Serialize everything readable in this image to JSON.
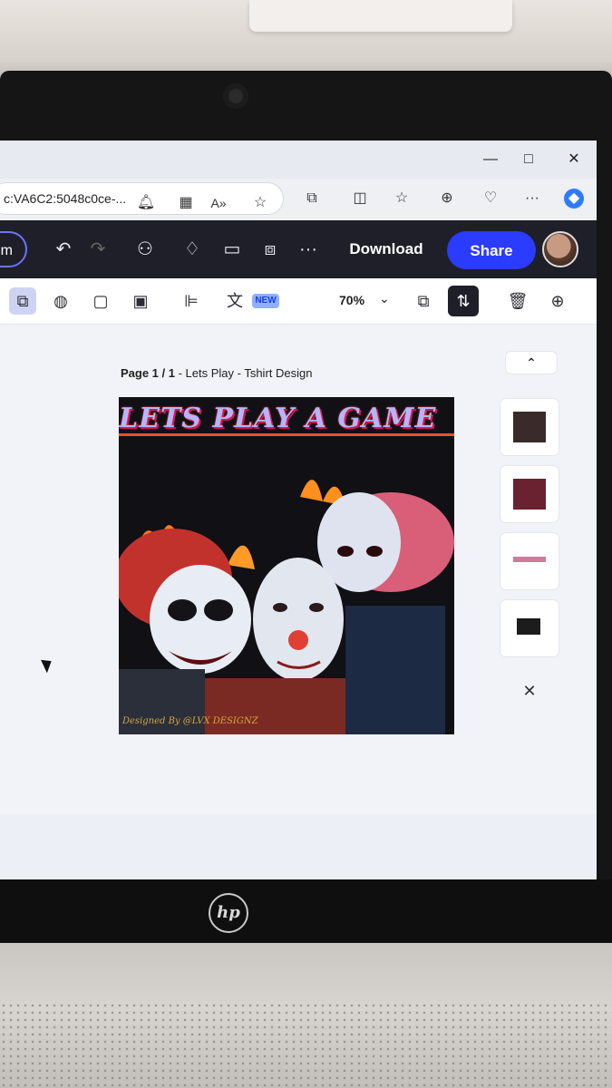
{
  "browser": {
    "url_fragment": "c:VA6C2:5048c0ce-..."
  },
  "appbar": {
    "left_pill_label": "m",
    "download_label": "Download",
    "share_label": "Share"
  },
  "toolbar": {
    "new_badge": "NEW",
    "zoom_value": "70%"
  },
  "canvas": {
    "page_label_strong": "Page 1 / 1",
    "page_label_rest": " - Lets Play - Tshirt Design",
    "design_title": "LETS PLAY A GAME",
    "design_footer": "Designed By @LVX DESIGNZ"
  },
  "taskbar": {
    "apps": [
      "file-explorer",
      "edge",
      "store",
      "myhp",
      "help",
      "mcafee",
      "outlook-new",
      "youtube-music",
      "instagram",
      "youtube",
      "facebook",
      "opera",
      "spotify"
    ]
  },
  "laptop": {
    "brand": "hp"
  }
}
